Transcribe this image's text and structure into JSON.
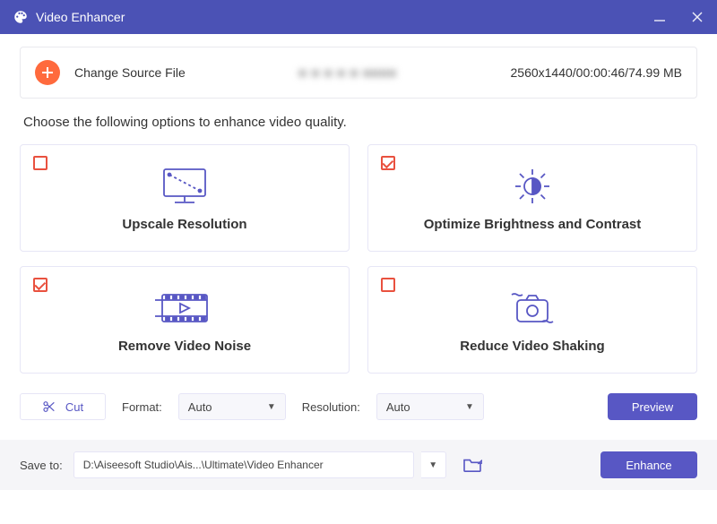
{
  "title": "Video Enhancer",
  "source": {
    "change_label": "Change Source File",
    "filename_blurred": "■ ■ ■ ■ ■   ■■■■",
    "meta": "2560x1440/00:00:46/74.99 MB"
  },
  "instruction": "Choose the following options to enhance video quality.",
  "cards": {
    "upscale": {
      "title": "Upscale Resolution",
      "checked": false
    },
    "brightness": {
      "title": "Optimize Brightness and Contrast",
      "checked": true
    },
    "noise": {
      "title": "Remove Video Noise",
      "checked": true
    },
    "shaking": {
      "title": "Reduce Video Shaking",
      "checked": false
    }
  },
  "controls": {
    "cut": "Cut",
    "format_label": "Format:",
    "format_value": "Auto",
    "resolution_label": "Resolution:",
    "resolution_value": "Auto",
    "preview": "Preview"
  },
  "footer": {
    "save_to_label": "Save to:",
    "path": "D:\\Aiseesoft Studio\\Ais...\\Ultimate\\Video Enhancer",
    "enhance": "Enhance"
  }
}
